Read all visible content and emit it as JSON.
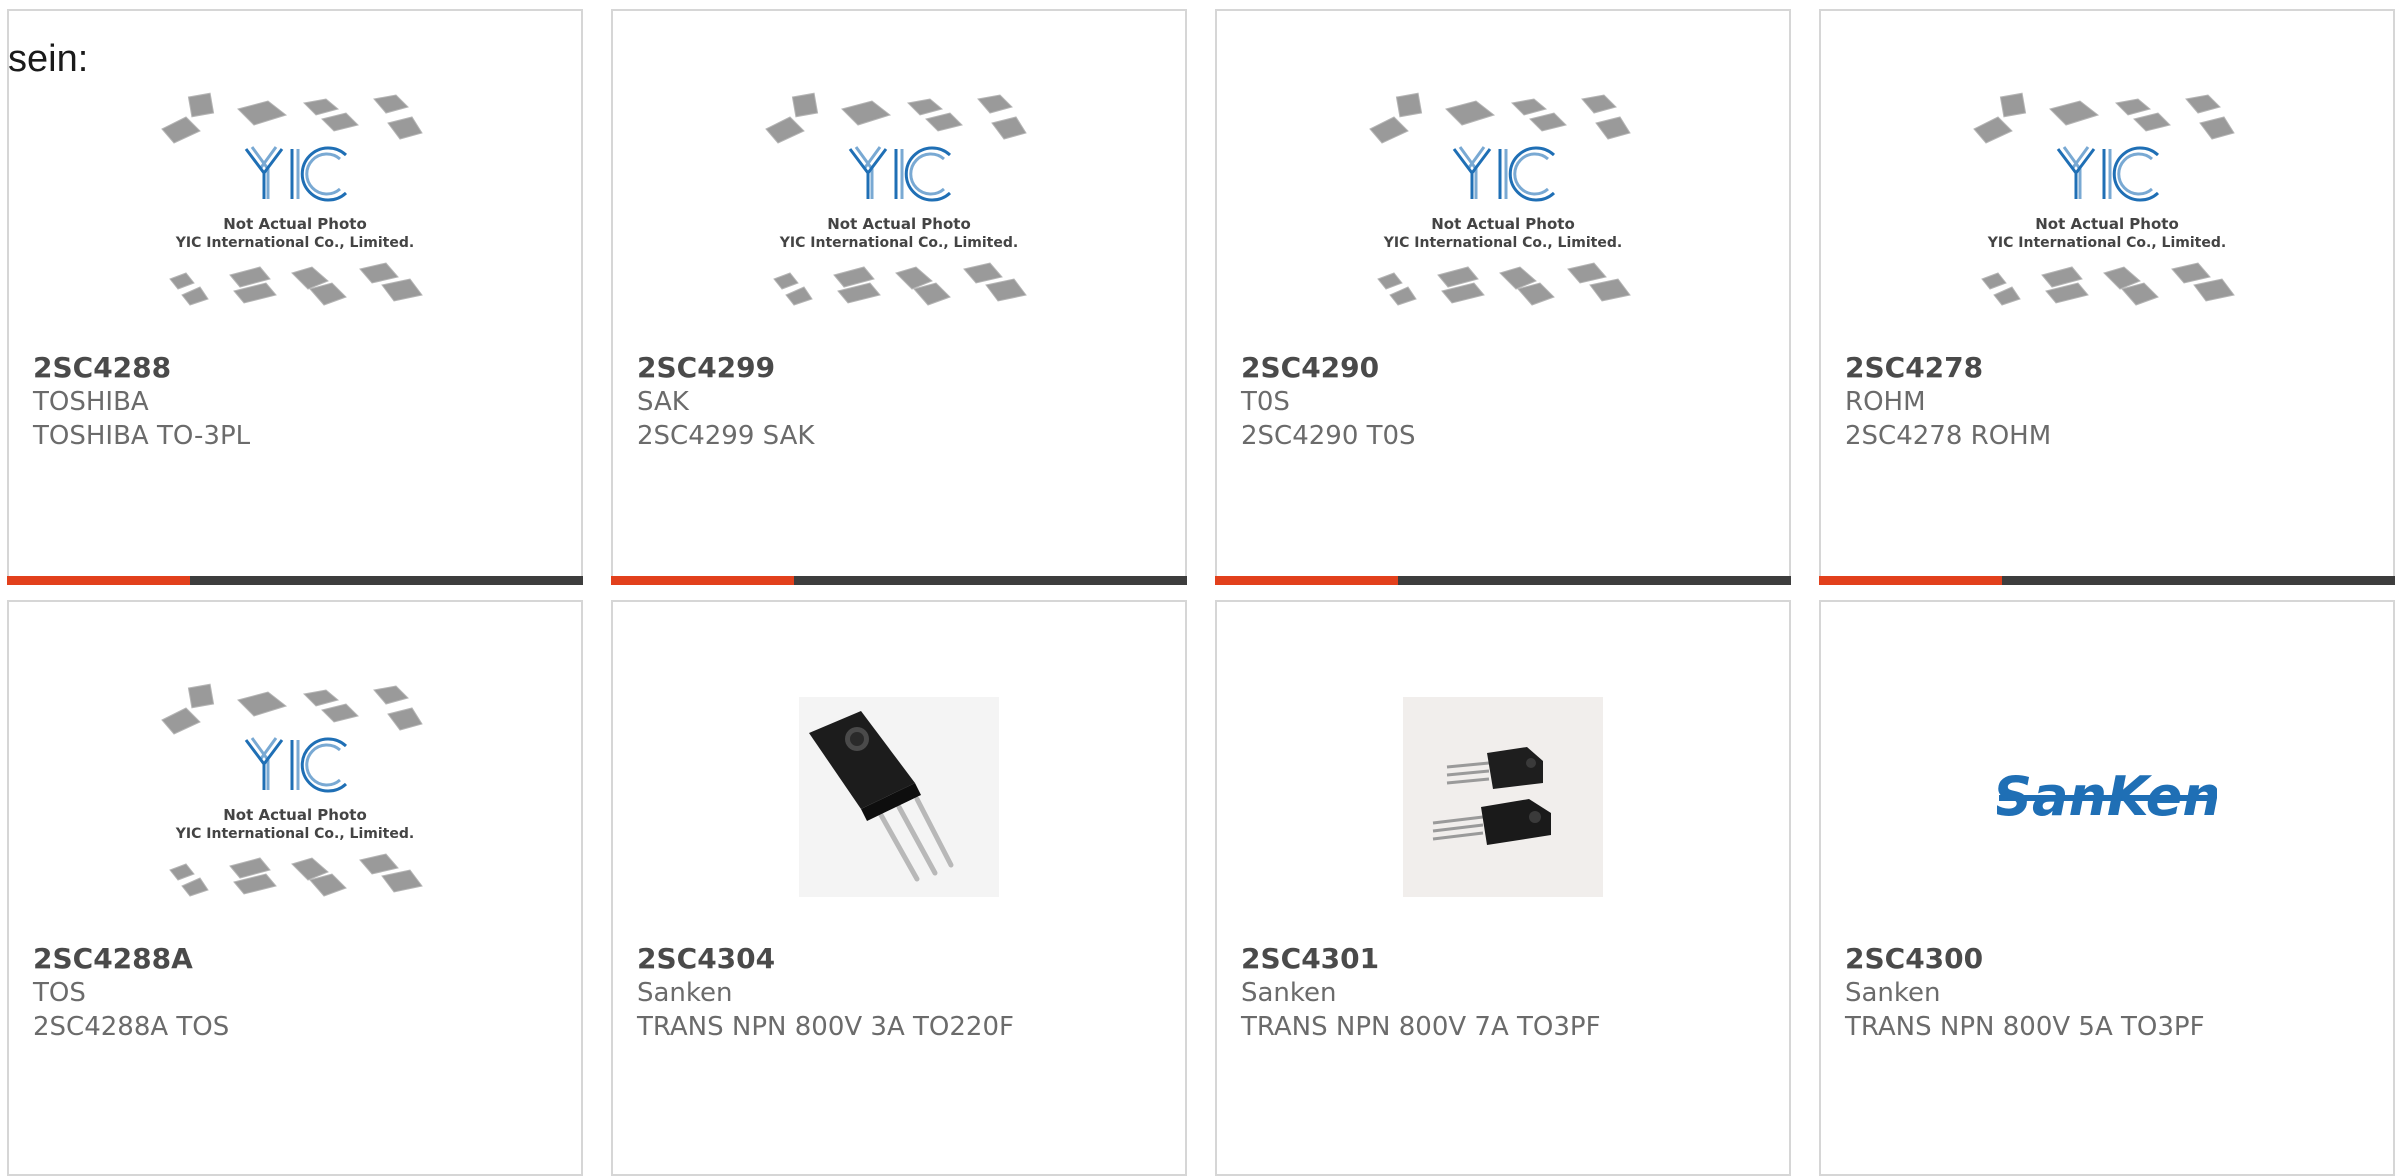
{
  "intro_text": "sein:",
  "placeholder": {
    "line1": "Not Actual Photo",
    "line2": "YIC International Co., Limited.",
    "logo": "YIC"
  },
  "sanken_logo": "SanKen",
  "colors": {
    "accent": "#e2401c",
    "bar_dark": "#3d3d3d",
    "logo_blue": "#1f6fb5",
    "border": "#d6d6d6"
  },
  "products": [
    {
      "part": "2SC4288",
      "manufacturer": "TOSHIBA",
      "description": "TOSHIBA TO-3PL",
      "image": "yic-placeholder"
    },
    {
      "part": "2SC4299",
      "manufacturer": "SAK",
      "description": "2SC4299 SAK",
      "image": "yic-placeholder"
    },
    {
      "part": "2SC4290",
      "manufacturer": "T0S",
      "description": "2SC4290 T0S",
      "image": "yic-placeholder"
    },
    {
      "part": "2SC4278",
      "manufacturer": "ROHM",
      "description": "2SC4278 ROHM",
      "image": "yic-placeholder"
    },
    {
      "part": "2SC4288A",
      "manufacturer": "TOS",
      "description": "2SC4288A TOS",
      "image": "yic-placeholder"
    },
    {
      "part": "2SC4304",
      "manufacturer": "Sanken",
      "description": "TRANS NPN 800V 3A TO220F",
      "image": "transistor-photo"
    },
    {
      "part": "2SC4301",
      "manufacturer": "Sanken",
      "description": "TRANS NPN 800V 7A TO3PF",
      "image": "transistor-pair-photo"
    },
    {
      "part": "2SC4300",
      "manufacturer": "Sanken",
      "description": "TRANS NPN 800V 5A TO3PF",
      "image": "sanken-logo"
    }
  ]
}
